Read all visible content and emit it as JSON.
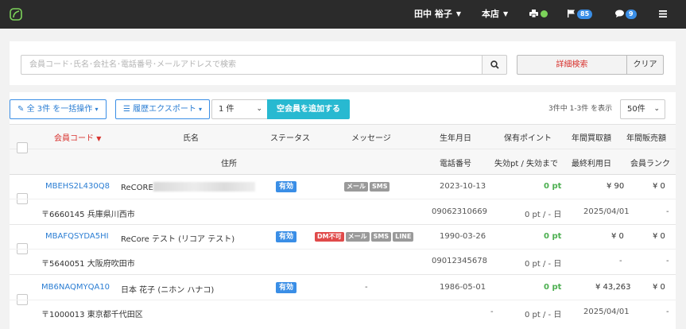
{
  "topbar": {
    "user": "田中 裕子",
    "store": "本店",
    "flag_count": "85",
    "chat_count": "9"
  },
  "search": {
    "placeholder": "会員コード･氏名･会社名･電話番号･メールアドレスで検索",
    "advanced_label": "詳細検索",
    "clear_label": "クリア"
  },
  "toolbar": {
    "bulk_label": "全 3件 を一括操作",
    "export_label": "履歴エクスポート",
    "count_select": "1 件",
    "add_label": "空会員を追加する",
    "result_text": "3件中 1-3件 を表示",
    "per_page": "50件"
  },
  "headers": {
    "code": "会員コード",
    "name": "氏名",
    "status": "ステータス",
    "message": "メッセージ",
    "birthday": "生年月日",
    "points": "保有ポイント",
    "annual_buy": "年間買取額",
    "annual_sell": "年間販売額",
    "address": "住所",
    "phone": "電話番号",
    "expire": "失効pt / 失効まで",
    "last_used": "最終利用日",
    "rank": "会員ランク"
  },
  "rows": [
    {
      "code": "MBEHS2L430Q8",
      "name": "ReCORE",
      "status": "有効",
      "messages": [
        "メール",
        "SMS"
      ],
      "birthday": "2023-10-13",
      "points": "0 pt",
      "annual_buy": "¥ 90",
      "annual_sell": "¥ 0",
      "address": "〒6660145 兵庫県川西市",
      "phone": "09062310669",
      "expire": "0 pt / - 日",
      "last_used": "2025/04/01",
      "rank": "-"
    },
    {
      "code": "MBAFQSYDA5HI",
      "name": "ReCore テスト (リコア テスト)",
      "status": "有効",
      "messages": [
        "DM不可",
        "メール",
        "SMS",
        "LINE"
      ],
      "birthday": "1990-03-26",
      "points": "0 pt",
      "annual_buy": "¥ 0",
      "annual_sell": "¥ 0",
      "address": "〒5640051 大阪府吹田市",
      "phone": "09012345678",
      "expire": "0 pt / - 日",
      "last_used": "-",
      "rank": "-"
    },
    {
      "code": "MB6NAQMYQA10",
      "name": "日本 花子 (ニホン ハナコ)",
      "status": "有効",
      "messages": [
        "-"
      ],
      "birthday": "1986-05-01",
      "points": "0 pt",
      "annual_buy": "¥ 43,263",
      "annual_sell": "¥ 0",
      "address": "〒1000013 東京都千代田区",
      "phone": "-",
      "expire": "0 pt / - 日",
      "last_used": "2025/04/01",
      "rank": "-"
    }
  ]
}
